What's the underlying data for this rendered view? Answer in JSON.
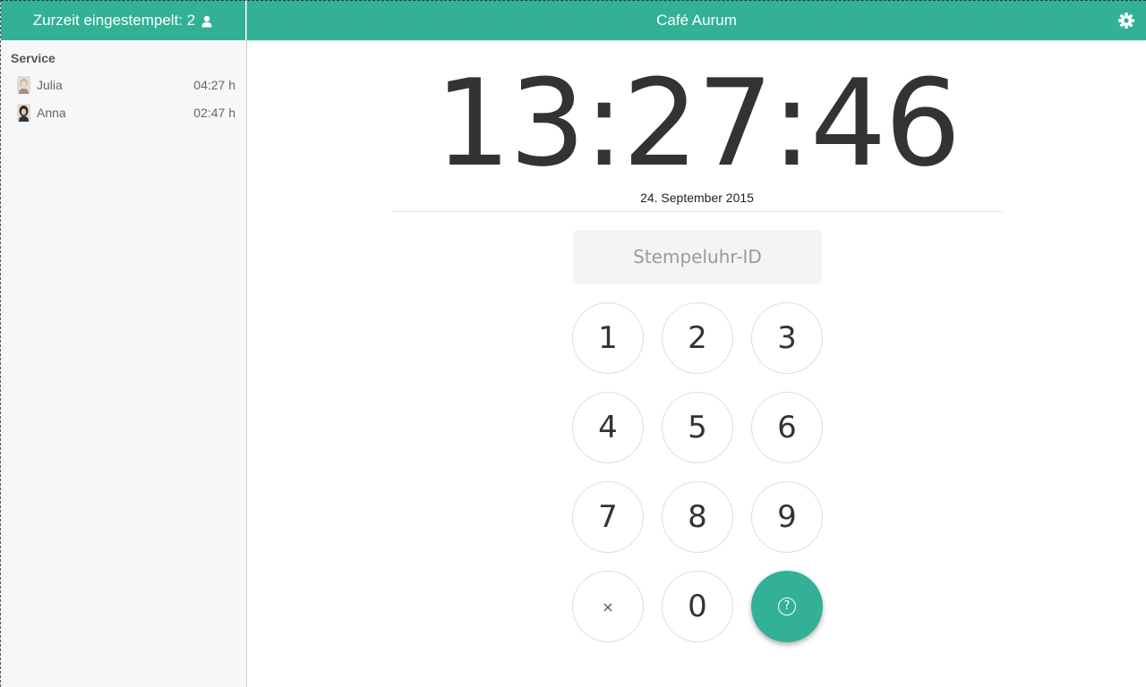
{
  "sidebar": {
    "header_label": "Zurzeit eingestempelt: 2",
    "header_icon": "user-icon",
    "group_title": "Service",
    "employees": [
      {
        "name": "Julia",
        "time": "04:27 h",
        "avatar": "avatar-julia"
      },
      {
        "name": "Anna",
        "time": "02:47 h",
        "avatar": "avatar-anna"
      }
    ]
  },
  "topbar": {
    "title": "Café Aurum",
    "settings_icon": "gear-icon"
  },
  "clock": {
    "time": "13:27:46",
    "date": "24. September 2015"
  },
  "id_input": {
    "placeholder": "Stempeluhr-ID",
    "value": ""
  },
  "keypad": {
    "keys": [
      "1",
      "2",
      "3",
      "4",
      "5",
      "6",
      "7",
      "8",
      "9",
      "×",
      "0",
      "?"
    ],
    "clear_icon": "close-icon",
    "help_icon": "question-circle-icon"
  },
  "colors": {
    "accent": "#32b197",
    "sidebar_bg": "#f7f7f7",
    "input_bg": "#f4f4f4"
  }
}
